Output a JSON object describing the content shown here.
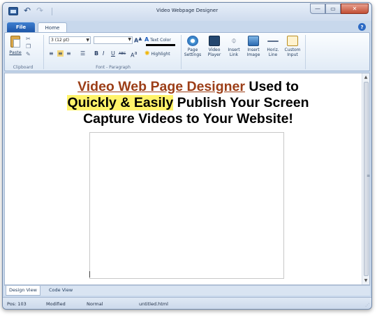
{
  "window": {
    "title": "Video Webpage Designer"
  },
  "quick_access": {
    "undo_icon": "undo-icon",
    "redo_icon": "redo-icon"
  },
  "window_controls": {
    "minimize": "—",
    "maximize": "▭",
    "close": "✕"
  },
  "tabs": {
    "file": "File",
    "home": "Home",
    "help": "?"
  },
  "ribbon": {
    "clipboard": {
      "paste": "Paste",
      "label": "Clipboard"
    },
    "font": {
      "size_value": "3 (12 pt)",
      "name_value": "",
      "text_color": "Text Color",
      "highlight": "Highlight",
      "bold": "B",
      "italic": "I",
      "underline": "U",
      "strike": "ABC",
      "superscript": "A",
      "grow": "A",
      "label": "Font - Paragraph"
    },
    "buttons": [
      {
        "label": "Page Settings",
        "icon": "page-settings-icon"
      },
      {
        "label": "Video Player",
        "icon": "video-player-icon"
      },
      {
        "label": "Insert Link",
        "icon": "link-icon"
      },
      {
        "label": "Insert Image",
        "icon": "image-icon"
      },
      {
        "label": "Horiz. Line",
        "icon": "horizontal-line-icon"
      },
      {
        "label": "Custom Input",
        "icon": "custom-input-icon"
      }
    ]
  },
  "editor": {
    "headline_link": "Video Web Page Designer",
    "headline_part1": " Used to",
    "headline_highlight": "Quickly & Easily",
    "headline_part2": " Publish Your Screen",
    "headline_line3": "Capture Videos to Your Website!"
  },
  "view_tabs": {
    "design": "Design View",
    "code": "Code View"
  },
  "status": {
    "position": "Pos: 103",
    "modified": "Modified",
    "mode": "Normal",
    "file": "untitled.html"
  },
  "colors": {
    "headline_link": "#9c3e17",
    "highlight": "#fff36a",
    "file_tab": "#1d56a8"
  }
}
